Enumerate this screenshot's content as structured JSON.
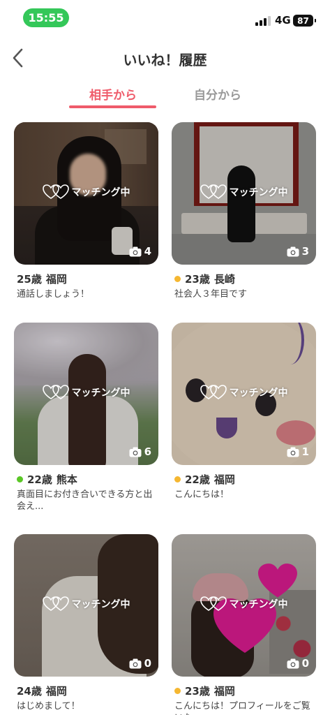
{
  "status_bar": {
    "time": "15:55",
    "network": "4G",
    "battery": "87"
  },
  "header": {
    "title": "いいね！履歴"
  },
  "tabs": [
    {
      "label": "相手から",
      "active": true
    },
    {
      "label": "自分から",
      "active": false
    }
  ],
  "colors": {
    "accent": "#ef5b6a",
    "online": "#5ac726",
    "recent": "#f5b731"
  },
  "cards": [
    {
      "badge": "マッチング中",
      "photo_count": "4",
      "age": "25歳",
      "location": "福岡",
      "status": "none",
      "bio": "通話しましょう！"
    },
    {
      "badge": "マッチング中",
      "photo_count": "3",
      "age": "23歳",
      "location": "長崎",
      "status": "recent",
      "bio": "社会人３年目です"
    },
    {
      "badge": "マッチング中",
      "photo_count": "6",
      "age": "22歳",
      "location": "熊本",
      "status": "online",
      "bio": "真面目にお付き合いできる方と出会え..."
    },
    {
      "badge": "マッチング中",
      "photo_count": "1",
      "age": "22歳",
      "location": "福岡",
      "status": "recent",
      "bio": "こんにちは！"
    },
    {
      "badge": "マッチング中",
      "photo_count": "0",
      "age": "24歳",
      "location": "福岡",
      "status": "none",
      "bio": "はじめまして！"
    },
    {
      "badge": "マッチング中",
      "photo_count": "0",
      "age": "23歳",
      "location": "福岡",
      "status": "recent",
      "bio": "こんにちは！プロフィールをご覧いた"
    }
  ],
  "icons": {
    "back": "chevron-left-icon",
    "match": "linked-hearts-icon",
    "camera": "camera-icon"
  }
}
